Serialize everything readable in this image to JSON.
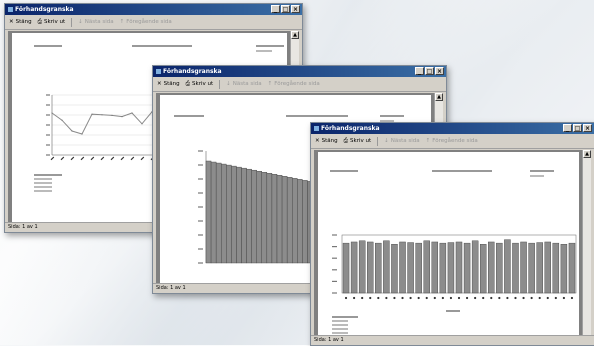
{
  "windows": [
    {
      "title": "Förhandsgranska",
      "toolbar": {
        "close": "Stäng",
        "print": "Skriv ut",
        "next": "Nästa sida",
        "prev": "Föregående sida"
      },
      "status": "Sida: 1 av 1"
    },
    {
      "title": "Förhandsgranska",
      "toolbar": {
        "close": "Stäng",
        "print": "Skriv ut",
        "next": "Nästa sida",
        "prev": "Föregående sida"
      },
      "status": "Sida: 1 av 1"
    },
    {
      "title": "Förhandsgranska",
      "toolbar": {
        "close": "Stäng",
        "print": "Skriv ut",
        "next": "Nästa sida",
        "prev": "Föregående sida"
      },
      "status": "Sida: 1 av 1"
    }
  ],
  "chart_data": [
    {
      "type": "line",
      "series": [
        {
          "values": [
            70,
            58,
            40,
            35,
            68,
            67,
            66,
            64,
            70,
            52,
            72,
            69,
            62
          ]
        }
      ],
      "ylim": [
        0,
        100
      ]
    },
    {
      "type": "bar",
      "values": [
        100,
        99,
        98,
        97,
        96,
        95,
        94,
        93,
        92,
        91,
        90,
        89,
        88,
        87,
        86,
        85,
        84,
        83,
        82,
        81,
        80,
        79,
        78,
        77,
        76,
        75,
        74,
        73
      ]
    },
    {
      "type": "bar",
      "values": [
        86,
        88,
        90,
        88,
        86,
        90,
        84,
        88,
        87,
        86,
        90,
        88,
        86,
        87,
        88,
        86,
        90,
        84,
        88,
        86,
        92,
        86,
        88,
        86,
        87,
        88,
        86,
        84,
        86
      ],
      "ylim": [
        0,
        100
      ]
    }
  ]
}
